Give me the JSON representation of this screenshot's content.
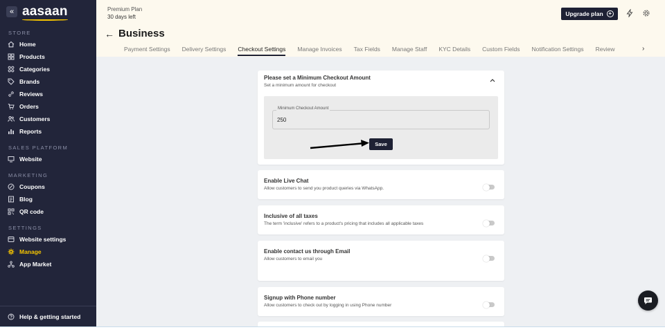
{
  "sidebar": {
    "logo": "aasaan",
    "collapse_glyph": "«",
    "sections": {
      "store": "STORE",
      "sales_platform": "SALES PLATFORM",
      "marketing": "MARKETING",
      "settings": "SETTINGS"
    },
    "items": {
      "home": "Home",
      "products": "Products",
      "categories": "Categories",
      "brands": "Brands",
      "reviews": "Reviews",
      "orders": "Orders",
      "customers": "Customers",
      "reports": "Reports",
      "website": "Website",
      "coupons": "Coupons",
      "blog": "Blog",
      "qr_code": "QR code",
      "website_settings": "Website settings",
      "manage": "Manage",
      "app_market": "App Market"
    },
    "active_item": "manage",
    "help": "Help & getting started"
  },
  "header": {
    "plan_name": "Premium Plan",
    "plan_days": "30 days left",
    "upgrade_label": "Upgrade plan",
    "title": "Business",
    "tabs": {
      "payment": "Payment Settings",
      "delivery": "Delivery Settings",
      "checkout": "Checkout Settings",
      "invoices": "Manage Invoices",
      "tax": "Tax Fields",
      "staff": "Manage Staff",
      "kyc": "KYC Details",
      "custom": "Custom Fields",
      "notification": "Notification Settings",
      "review": "Review"
    },
    "active_tab": "checkout"
  },
  "checkout": {
    "min_amount": {
      "title": "Please set a Minimum Checkout Amount",
      "subtitle": "Set a minimum amount for checkout",
      "field_label": "Minimum Checkout Amount",
      "field_value": "250",
      "save_label": "Save"
    },
    "live_chat": {
      "title": "Enable Live Chat",
      "subtitle": "Allow customers to send you product queries via WhatsApp.",
      "enabled": false
    },
    "taxes": {
      "title": "Inclusive of all taxes",
      "subtitle": "The term 'inclusive' refers to a product's pricing that includes all applicable taxes",
      "enabled": false
    },
    "email": {
      "title": "Enable contact us through Email",
      "subtitle": "Allow customers to email you",
      "enabled": false
    },
    "phone_signup": {
      "title": "Signup with Phone number",
      "subtitle": "Allow customers to check out by logging in using Phone number",
      "enabled": false
    }
  },
  "colors": {
    "sidebar_bg": "#22253a",
    "accent": "#f5c400",
    "header_bg": "#fdf9ee",
    "main_bg": "#eef0f3",
    "button_dark": "#1e2134"
  }
}
